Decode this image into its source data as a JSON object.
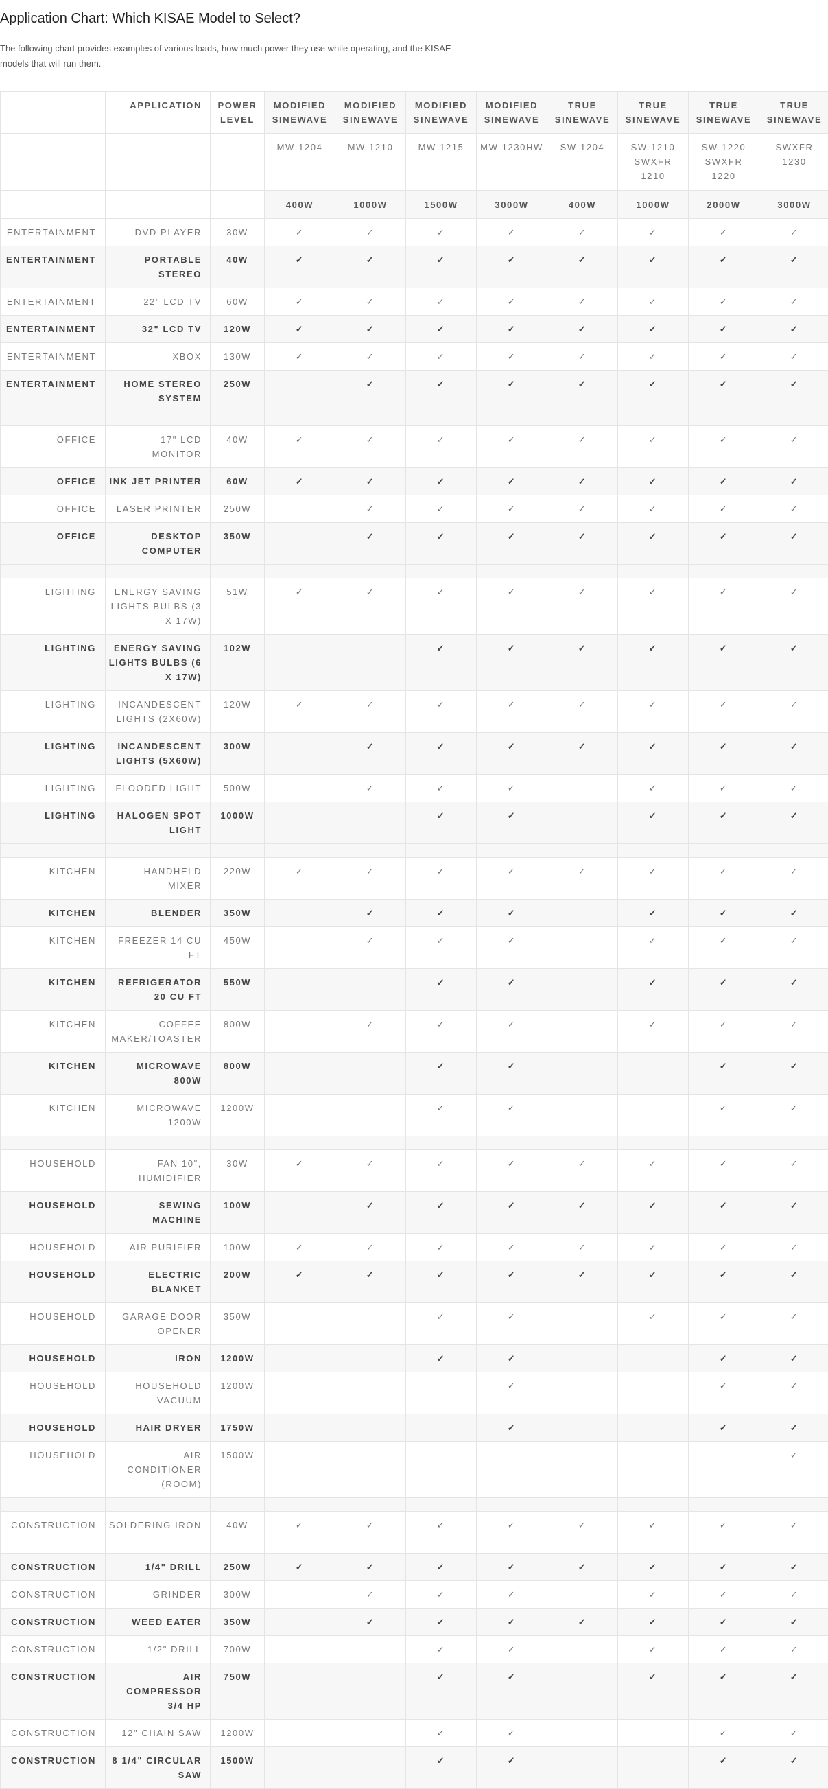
{
  "title": "Application Chart: Which KISAE Model to Select?",
  "intro": "The following chart provides examples of various loads, how much power they use while operating, and the KISAE models that will run them.",
  "header": {
    "application": "Application",
    "power_level": "Power Level",
    "types": [
      "Modified Sinewave",
      "Modified Sinewave",
      "Modified Sinewave",
      "Modified Sinewave",
      "True Sinewave",
      "True Sinewave",
      "True Sinewave",
      "True Sinewave"
    ],
    "models": [
      "MW 1204",
      "MW 1210",
      "MW 1215",
      "MW 1230HW",
      "SW 1204",
      "SW 1210 SWXFR 1210",
      "SW 1220 SWXFR 1220",
      "SWXFR 1230"
    ],
    "ratings": [
      "400W",
      "1000W",
      "1500W",
      "3000W",
      "400W",
      "1000W",
      "2000W",
      "3000W"
    ]
  },
  "check_mark": "✓",
  "rows": [
    {
      "category": "Entertainment",
      "application": "DVD Player",
      "power": "30W",
      "supported": [
        1,
        1,
        1,
        1,
        1,
        1,
        1,
        1
      ],
      "lines": 1
    },
    {
      "category": "Entertainment",
      "application": "Portable Stereo",
      "power": "40W",
      "supported": [
        1,
        1,
        1,
        1,
        1,
        1,
        1,
        1
      ],
      "lines": 2
    },
    {
      "category": "Entertainment",
      "application": "22\" LCD TV",
      "power": "60W",
      "supported": [
        1,
        1,
        1,
        1,
        1,
        1,
        1,
        1
      ],
      "lines": 1
    },
    {
      "category": "Entertainment",
      "application": "32\" LCD TV",
      "power": "120W",
      "supported": [
        1,
        1,
        1,
        1,
        1,
        1,
        1,
        1
      ],
      "lines": 1
    },
    {
      "category": "Entertainment",
      "application": "XBOX",
      "power": "130W",
      "supported": [
        1,
        1,
        1,
        1,
        1,
        1,
        1,
        1
      ],
      "lines": 1
    },
    {
      "category": "Entertainment",
      "application": "Home Stereo System",
      "power": "250W",
      "supported": [
        0,
        1,
        1,
        1,
        1,
        1,
        1,
        1
      ],
      "lines": 2
    },
    {
      "spacer": true
    },
    {
      "category": "Office",
      "application": "17\" LCD Monitor",
      "power": "40W",
      "supported": [
        1,
        1,
        1,
        1,
        1,
        1,
        1,
        1
      ],
      "lines": 2
    },
    {
      "category": "Office",
      "application": "Ink Jet Printer",
      "power": "60W",
      "supported": [
        1,
        1,
        1,
        1,
        1,
        1,
        1,
        1
      ],
      "lines": 1
    },
    {
      "category": "Office",
      "application": "Laser Printer",
      "power": "250W",
      "supported": [
        0,
        1,
        1,
        1,
        1,
        1,
        1,
        1
      ],
      "lines": 1
    },
    {
      "category": "Office",
      "application": "Desktop Computer",
      "power": "350W",
      "supported": [
        0,
        1,
        1,
        1,
        1,
        1,
        1,
        1
      ],
      "lines": 2
    },
    {
      "spacer": true
    },
    {
      "category": "Lighting",
      "application": "Energy Saving Lights Bulbs (3 x 17W)",
      "power": "51W",
      "supported": [
        1,
        1,
        1,
        1,
        1,
        1,
        1,
        1
      ],
      "lines": 3
    },
    {
      "category": "Lighting",
      "application": "Energy Saving Lights Bulbs (6 x 17W)",
      "power": "102W",
      "supported": [
        0,
        0,
        1,
        1,
        1,
        1,
        1,
        1
      ],
      "lines": 3
    },
    {
      "category": "Lighting",
      "application": "Incandescent Lights (2x60W)",
      "power": "120W",
      "supported": [
        1,
        1,
        1,
        1,
        1,
        1,
        1,
        1
      ],
      "lines": 2
    },
    {
      "category": "Lighting",
      "application": "Incandescent Lights (5x60W)",
      "power": "300W",
      "supported": [
        0,
        1,
        1,
        1,
        1,
        1,
        1,
        1
      ],
      "lines": 2
    },
    {
      "category": "Lighting",
      "application": "Flooded Light",
      "power": "500W",
      "supported": [
        0,
        1,
        1,
        1,
        0,
        1,
        1,
        1
      ],
      "lines": 1
    },
    {
      "category": "Lighting",
      "application": "Halogen Spot Light",
      "power": "1000W",
      "supported": [
        0,
        0,
        1,
        1,
        0,
        1,
        1,
        1
      ],
      "lines": 2
    },
    {
      "spacer": true
    },
    {
      "category": "Kitchen",
      "application": "Handheld Mixer",
      "power": "220W",
      "supported": [
        1,
        1,
        1,
        1,
        1,
        1,
        1,
        1
      ],
      "lines": 2
    },
    {
      "category": "Kitchen",
      "application": "Blender",
      "power": "350W",
      "supported": [
        0,
        1,
        1,
        1,
        0,
        1,
        1,
        1
      ],
      "lines": 1
    },
    {
      "category": "Kitchen",
      "application": "Freezer 14 cu ft",
      "power": "450W",
      "supported": [
        0,
        1,
        1,
        1,
        0,
        1,
        1,
        1
      ],
      "lines": 2
    },
    {
      "category": "Kitchen",
      "application": "Refrigerator 20 cu ft",
      "power": "550W",
      "supported": [
        0,
        0,
        1,
        1,
        0,
        1,
        1,
        1
      ],
      "lines": 2
    },
    {
      "category": "Kitchen",
      "application": "Coffee Maker/Toaster",
      "power": "800W",
      "supported": [
        0,
        1,
        1,
        1,
        0,
        1,
        1,
        1
      ],
      "lines": 2
    },
    {
      "category": "Kitchen",
      "application": "Microwave 800W",
      "power": "800W",
      "supported": [
        0,
        0,
        1,
        1,
        0,
        0,
        1,
        1
      ],
      "lines": 2
    },
    {
      "category": "Kitchen",
      "application": "Microwave 1200W",
      "power": "1200W",
      "supported": [
        0,
        0,
        1,
        1,
        0,
        0,
        1,
        1
      ],
      "lines": 2
    },
    {
      "spacer": true
    },
    {
      "category": "Household",
      "application": "Fan 10\", Humidifier",
      "power": "30W",
      "supported": [
        1,
        1,
        1,
        1,
        1,
        1,
        1,
        1
      ],
      "lines": 2
    },
    {
      "category": "Household",
      "application": "Sewing Machine",
      "power": "100W",
      "supported": [
        0,
        1,
        1,
        1,
        1,
        1,
        1,
        1
      ],
      "lines": 2
    },
    {
      "category": "Household",
      "application": "Air Purifier",
      "power": "100W",
      "supported": [
        1,
        1,
        1,
        1,
        1,
        1,
        1,
        1
      ],
      "lines": 1
    },
    {
      "category": "Household",
      "application": "Electric Blanket",
      "power": "200W",
      "supported": [
        1,
        1,
        1,
        1,
        1,
        1,
        1,
        1
      ],
      "lines": 2
    },
    {
      "category": "Household",
      "application": "Garage Door Opener",
      "power": "350W",
      "supported": [
        0,
        0,
        1,
        1,
        0,
        1,
        1,
        1
      ],
      "lines": 2
    },
    {
      "category": "Household",
      "application": "Iron",
      "power": "1200W",
      "supported": [
        0,
        0,
        1,
        1,
        0,
        0,
        1,
        1
      ],
      "lines": 1
    },
    {
      "category": "Household",
      "application": "Household Vacuum",
      "power": "1200W",
      "supported": [
        0,
        0,
        0,
        1,
        0,
        0,
        1,
        1
      ],
      "lines": 2
    },
    {
      "category": "Household",
      "application": "Hair Dryer",
      "power": "1750W",
      "supported": [
        0,
        0,
        0,
        1,
        0,
        0,
        1,
        1
      ],
      "lines": 1
    },
    {
      "category": "Household",
      "application": "Air Conditioner (room)",
      "power": "1500W",
      "supported": [
        0,
        0,
        0,
        0,
        0,
        0,
        0,
        1
      ],
      "lines": 3
    },
    {
      "spacer": true
    },
    {
      "category": "Construction",
      "application": "Soldering Iron",
      "power": "40W",
      "supported": [
        1,
        1,
        1,
        1,
        1,
        1,
        1,
        1
      ],
      "lines": 2
    },
    {
      "category": "Construction",
      "application": "1/4\" Drill",
      "power": "250W",
      "supported": [
        1,
        1,
        1,
        1,
        1,
        1,
        1,
        1
      ],
      "lines": 1
    },
    {
      "category": "Construction",
      "application": "Grinder",
      "power": "300W",
      "supported": [
        0,
        1,
        1,
        1,
        0,
        1,
        1,
        1
      ],
      "lines": 1
    },
    {
      "category": "Construction",
      "application": "Weed Eater",
      "power": "350W",
      "supported": [
        0,
        1,
        1,
        1,
        1,
        1,
        1,
        1
      ],
      "lines": 1
    },
    {
      "category": "Construction",
      "application": "1/2\" Drill",
      "power": "700W",
      "supported": [
        0,
        0,
        1,
        1,
        0,
        1,
        1,
        1
      ],
      "lines": 1
    },
    {
      "category": "Construction",
      "application": "Air Compressor 3/4 HP",
      "power": "750W",
      "supported": [
        0,
        0,
        1,
        1,
        0,
        1,
        1,
        1
      ],
      "lines": 3
    },
    {
      "category": "Construction",
      "application": "12\" Chain Saw",
      "power": "1200W",
      "supported": [
        0,
        0,
        1,
        1,
        0,
        0,
        1,
        1
      ],
      "lines": 1
    },
    {
      "category": "Construction",
      "application": "8 1/4\" Circular Saw",
      "power": "1500W",
      "supported": [
        0,
        0,
        1,
        1,
        0,
        0,
        1,
        1
      ],
      "lines": 2
    }
  ]
}
